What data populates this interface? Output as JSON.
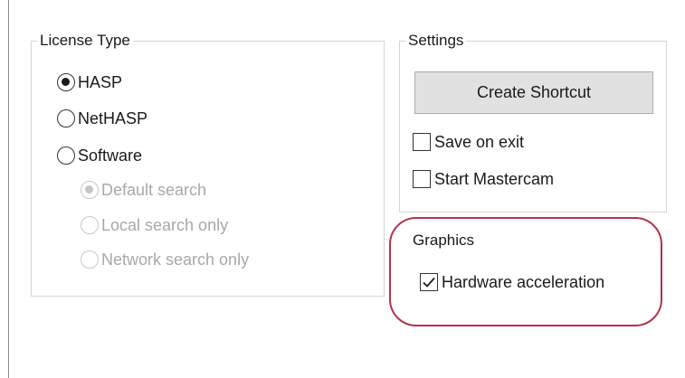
{
  "license_type": {
    "label": "License Type",
    "options": [
      {
        "label": "HASP",
        "checked": true,
        "disabled": false
      },
      {
        "label": "NetHASP",
        "checked": false,
        "disabled": false
      },
      {
        "label": "Software",
        "checked": false,
        "disabled": false
      }
    ],
    "software_search_options": [
      {
        "label": "Default search",
        "checked": true,
        "disabled": true
      },
      {
        "label": "Local search only",
        "checked": false,
        "disabled": true
      },
      {
        "label": "Network search only",
        "checked": false,
        "disabled": true
      }
    ]
  },
  "settings": {
    "label": "Settings",
    "create_shortcut_label": "Create Shortcut",
    "save_on_exit": {
      "label": "Save on exit",
      "checked": false
    },
    "start_mastercam": {
      "label": "Start Mastercam",
      "checked": false
    }
  },
  "graphics": {
    "label": "Graphics",
    "hardware_acceleration": {
      "label": "Hardware acceleration",
      "checked": true
    }
  },
  "colors": {
    "highlight_ring": "#b2334d",
    "button_bg": "#e1e1e1",
    "disabled_text": "#a8a8a8"
  }
}
